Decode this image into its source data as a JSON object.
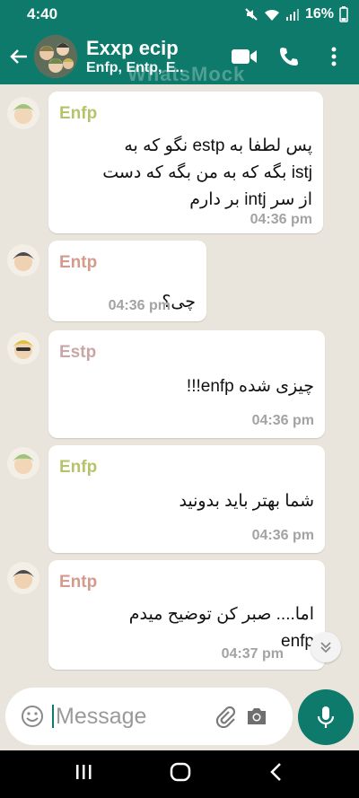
{
  "status": {
    "time": "4:40",
    "battery": "16%"
  },
  "header": {
    "title": "Exxp ecip",
    "subtitle": "Enfp, Entp, E..",
    "watermark": "WhatsMock"
  },
  "messages": [
    {
      "sender": "Enfp",
      "sender_color": "#b7c36a",
      "text": [
        "پس لطفا به estp نگو که به",
        "istj بگه که به من بگه که دست",
        "از سر intj بر دارم"
      ],
      "time": "04:36 pm"
    },
    {
      "sender": "Entp",
      "sender_color": "#d49a8c",
      "text": [
        "چی؟"
      ],
      "time": "04:36 pm"
    },
    {
      "sender": "Estp",
      "sender_color": "#c9a5a5",
      "text": [
        "چیزی شده enfp!!!"
      ],
      "time": "04:36 pm"
    },
    {
      "sender": "Enfp",
      "sender_color": "#b7c36a",
      "text": [
        "شما بهتر باید بدونید"
      ],
      "time": "04:36 pm"
    },
    {
      "sender": "Entp",
      "sender_color": "#d49a8c",
      "text": [
        "اما.... صبر کن توضیح میدم",
        "enfp"
      ],
      "time": "04:37 pm"
    }
  ],
  "composer": {
    "placeholder": "Message"
  },
  "colors": {
    "accent": "#0d7a6b",
    "chat_bg": "#e9e4dc"
  }
}
